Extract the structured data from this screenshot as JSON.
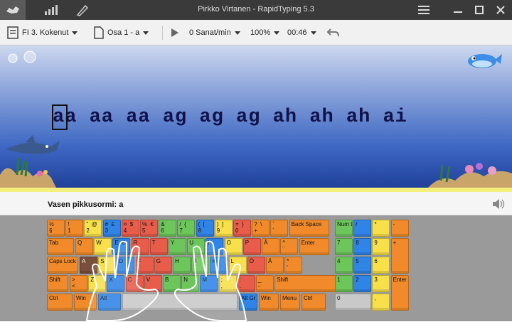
{
  "window": {
    "title": "Pirkko Virtanen - RapidTyping 5.3"
  },
  "titlebar": {
    "icons": [
      "home-icon",
      "stats-icon",
      "editor-icon"
    ]
  },
  "toolbar": {
    "course": "FI 3. Kokenut",
    "lesson": "Osa 1 - a",
    "speed": "0 Sanat/min",
    "zoom": "100%",
    "timer": "00:46"
  },
  "lesson_text": "aa aa aa ag ag ag ah ah ah ai",
  "hint": "Vasen pikkusormi: a",
  "colors": {
    "orange": "#f08a2a",
    "green": "#6cc65a",
    "blue": "#2f84e6",
    "yellow": "#f7e04a",
    "red": "#e85c4a"
  },
  "keyboard": {
    "row1": [
      "½\n§",
      "!\n1",
      "\"  @\n2",
      "#  £\n3",
      "¤  $\n4",
      "%  €\n5",
      "&\n6",
      "/  {\n7",
      "(  [\n8",
      ")  ]\n9",
      "=  }\n0",
      "?  \\\n+",
      "`\n´",
      "Back Space"
    ],
    "row2": [
      "Tab",
      "Q",
      "W",
      "E  €",
      "R",
      "T",
      "Y",
      "U",
      "I",
      "O",
      "P",
      "Å",
      "^\n¨",
      "Enter"
    ],
    "row3": [
      "Caps Lock",
      "A",
      "S",
      "D",
      "F",
      "G",
      "H",
      "J",
      "K",
      "L",
      "Ö",
      "Ä",
      "*\n'"
    ],
    "row4": [
      "Shift",
      ">\n<",
      "Z",
      "X",
      "C",
      "V",
      "B",
      "N",
      "M",
      ";\n,",
      ":\n.",
      "_\n-",
      "Shift"
    ],
    "row5": [
      "Ctrl",
      "Win",
      "Alt",
      "",
      "Alt Gr",
      "Win",
      "Menu",
      "Ctrl"
    ],
    "numpad": [
      "Num Lock",
      "/",
      "*",
      "-",
      "7",
      "8",
      "9",
      "+",
      "4",
      "5",
      "6",
      "1",
      "2",
      "3",
      "Enter",
      "0",
      ","
    ]
  }
}
